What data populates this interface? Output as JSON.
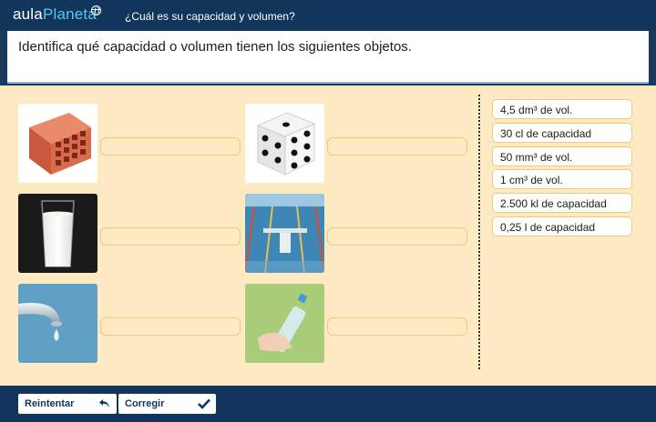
{
  "header": {
    "logo_part1": "aula",
    "logo_part2": "Planeta",
    "title": "¿Cuál es su capacidad y volumen?"
  },
  "question": "Identifica qué capacidad o volumen tienen los siguientes objetos.",
  "objects": [
    {
      "name": "brick",
      "icon": "brick-image"
    },
    {
      "name": "dice",
      "icon": "dice-image"
    },
    {
      "name": "milk-glass",
      "icon": "milk-glass-image"
    },
    {
      "name": "swimming-pool",
      "icon": "swimming-pool-image"
    },
    {
      "name": "dripping-tap",
      "icon": "tap-drop-image"
    },
    {
      "name": "water-bottle",
      "icon": "water-bottle-image"
    }
  ],
  "options": [
    "4,5 dm³ de vol.",
    "30 cl de capacidad",
    "50 mm³ de vol.",
    "1 cm³ de vol.",
    "2.500 kl de capacidad",
    "0,25 l de capacidad"
  ],
  "buttons": {
    "retry": "Reintentar",
    "check": "Corregir"
  },
  "colors": {
    "header": "#12355b",
    "workspace": "#fde9c2",
    "slot_border": "#f1c97e",
    "logo_accent": "#5cc6ef"
  }
}
